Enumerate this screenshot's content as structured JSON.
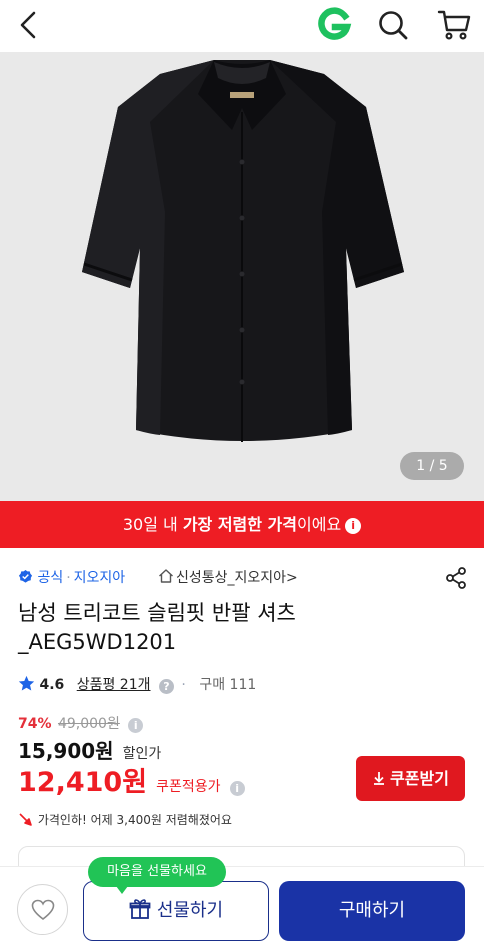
{
  "header": {
    "back_icon": "chevron-left-icon",
    "logo_letter": "G",
    "logo_color": "#1ec15f",
    "search_icon": "search-icon",
    "cart_icon": "cart-icon"
  },
  "gallery": {
    "counter": "1 / 5",
    "image_subject": "black short-sleeve dress shirt"
  },
  "promo_banner": {
    "prefix": "30일 내 ",
    "highlight": "가장 저렴한 가격",
    "suffix": "이에요",
    "info_icon": "info-icon",
    "color": "#ee1d24"
  },
  "seller": {
    "official_label": "공식",
    "brand": "지오지아",
    "store": "신성통상_지오지아",
    "store_chevron": ">"
  },
  "product": {
    "title": "남성 트리코트 슬림핏 반팔 셔츠_AEG5WD1201",
    "rating": "4.6",
    "reviews": "상품평 21개",
    "purchases": "구매 111"
  },
  "price": {
    "discount": "74%",
    "original": "49,000원",
    "sale": "15,900원",
    "sale_label": "할인가",
    "coupon_price": "12,410원",
    "coupon_label": "쿠폰적용가",
    "coupon_button": "쿠폰받기",
    "price_drop_note": "가격인하! 어제 3,400원 저렴해졌어요"
  },
  "bottom_bar": {
    "tooltip": "마음을 선물하세요",
    "gift_button": "선물하기",
    "buy_button": "구매하기",
    "primary_color": "#1a33a6"
  }
}
